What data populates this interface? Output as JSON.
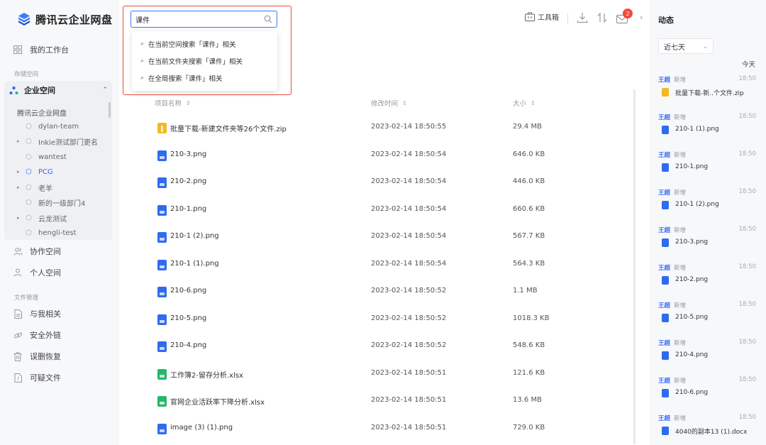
{
  "app": {
    "title": "腾讯云企业网盘"
  },
  "sidebar": {
    "workspace": "我的工作台",
    "storage_label": "存储空间",
    "enterprise": "企业空间",
    "tree_root": "腾讯云企业网盘",
    "tree": [
      {
        "label": "dylan-team",
        "has_arrow": false,
        "active": false
      },
      {
        "label": "Inkie测试部门更名",
        "has_arrow": true,
        "active": false
      },
      {
        "label": "wantest",
        "has_arrow": false,
        "active": false
      },
      {
        "label": "PCG",
        "has_arrow": true,
        "active": true
      },
      {
        "label": "老羊",
        "has_arrow": true,
        "active": false
      },
      {
        "label": "新的一级部门4",
        "has_arrow": false,
        "active": false
      },
      {
        "label": "云龙测试",
        "has_arrow": true,
        "active": false
      },
      {
        "label": "hengli-test",
        "has_arrow": false,
        "active": false
      }
    ],
    "collab": "协作空间",
    "personal": "个人空间",
    "file_mgmt_label": "文件管理",
    "related": "与我相关",
    "external": "安全外链",
    "recycle": "误删恢复",
    "suspicious": "可疑文件"
  },
  "search": {
    "value": "课件",
    "suggestions": [
      "在当前空间搜索「课件」相关",
      "在当前文件夹搜索「课件」相关",
      "在全局搜索「课件」相关"
    ]
  },
  "toolbar": {
    "toolbox": "工具箱",
    "badge": "2"
  },
  "table": {
    "headers": {
      "name": "项目名称",
      "modified": "修改时间",
      "size": "大小"
    },
    "rows": [
      {
        "type": "zip",
        "name": "批量下载-新建文件夹等26个文件.zip",
        "date": "2023-02-14 18:50:55",
        "size": "29.4 MB"
      },
      {
        "type": "png",
        "name": "210-3.png",
        "date": "2023-02-14 18:50:54",
        "size": "646.0 KB"
      },
      {
        "type": "png",
        "name": "210-2.png",
        "date": "2023-02-14 18:50:54",
        "size": "446.0 KB"
      },
      {
        "type": "png",
        "name": "210-1.png",
        "date": "2023-02-14 18:50:54",
        "size": "660.6 KB"
      },
      {
        "type": "png",
        "name": "210-1 (2).png",
        "date": "2023-02-14 18:50:54",
        "size": "567.7 KB"
      },
      {
        "type": "png",
        "name": "210-1 (1).png",
        "date": "2023-02-14 18:50:54",
        "size": "564.3 KB"
      },
      {
        "type": "png",
        "name": "210-6.png",
        "date": "2023-02-14 18:50:52",
        "size": "1.1 MB"
      },
      {
        "type": "png",
        "name": "210-5.png",
        "date": "2023-02-14 18:50:52",
        "size": "1018.3 KB"
      },
      {
        "type": "png",
        "name": "210-4.png",
        "date": "2023-02-14 18:50:52",
        "size": "548.6 KB"
      },
      {
        "type": "xlsx",
        "name": "工作簿2-留存分析.xlsx",
        "date": "2023-02-14 18:50:51",
        "size": "121.6 KB"
      },
      {
        "type": "xlsx",
        "name": "官网企业活跃率下降分析.xlsx",
        "date": "2023-02-14 18:50:51",
        "size": "13.6 MB"
      },
      {
        "type": "png",
        "name": "image (3) (1).png",
        "date": "2023-02-14 18:50:51",
        "size": "729.0 KB"
      }
    ]
  },
  "activity": {
    "title": "动态",
    "range": "近七天",
    "today": "今天",
    "items": [
      {
        "user": "王超",
        "verb": "新增",
        "time": "18:50",
        "type": "zip",
        "file": "批量下载-新..个文件.zip"
      },
      {
        "user": "王超",
        "verb": "新增",
        "time": "18:50",
        "type": "png",
        "file": "210-1 (1).png"
      },
      {
        "user": "王超",
        "verb": "新增",
        "time": "18:50",
        "type": "png",
        "file": "210-1.png"
      },
      {
        "user": "王超",
        "verb": "新增",
        "time": "18:50",
        "type": "png",
        "file": "210-1 (2).png"
      },
      {
        "user": "王超",
        "verb": "新增",
        "time": "18:50",
        "type": "png",
        "file": "210-3.png"
      },
      {
        "user": "王超",
        "verb": "新增",
        "time": "18:50",
        "type": "png",
        "file": "210-2.png"
      },
      {
        "user": "王超",
        "verb": "新增",
        "time": "18:50",
        "type": "png",
        "file": "210-5.png"
      },
      {
        "user": "王超",
        "verb": "新增",
        "time": "18:50",
        "type": "png",
        "file": "210-4.png"
      },
      {
        "user": "王超",
        "verb": "新增",
        "time": "18:50",
        "type": "png",
        "file": "210-6.png"
      },
      {
        "user": "王超",
        "verb": "新增",
        "time": "18:50",
        "type": "docx",
        "file": "4040的副本13 (1).docx"
      }
    ]
  },
  "colors": {
    "accent": "#3366ff",
    "highlight_border": "#e24c3c",
    "zip": "#f5b723",
    "png": "#2e6bf0",
    "xlsx": "#25b869",
    "badge": "#f24a3c"
  }
}
